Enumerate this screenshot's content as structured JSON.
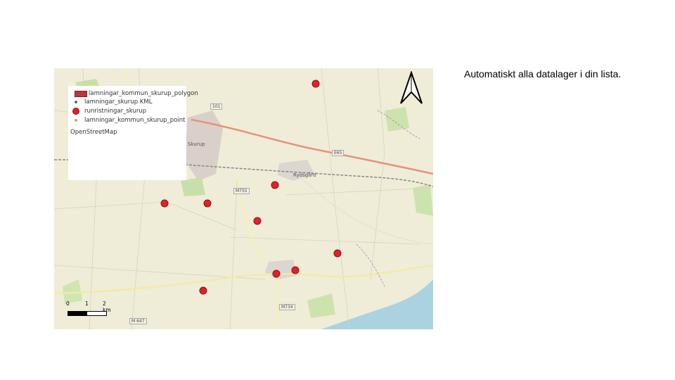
{
  "map": {
    "legend": {
      "items": [
        {
          "label": "lamningar_kommun_skurup_polygon",
          "symbol": "polygon-fill",
          "color": "#b83a3a"
        },
        {
          "label": "lamningar_skurup KML",
          "symbol": "dot",
          "color": "#666666"
        },
        {
          "label": "runristningar_skurup",
          "symbol": "red-circle",
          "color": "#e02020"
        },
        {
          "label": "lamningar_kommun_skurup_point",
          "symbol": "dot",
          "color": "#c8b040"
        }
      ],
      "basemap_label": "OpenStreetMap"
    },
    "place_labels": {
      "skurup": "Skurup",
      "rydsgard": "Rydsgård",
      "road_m755": "M755",
      "road_m734": "M734",
      "road_e65": "E65",
      "road_101": "101",
      "road_m647": "M 647"
    },
    "scale": {
      "tick_0": "0",
      "tick_1": "1",
      "tick_2": "2 km"
    },
    "north_arrow": "north-arrow-icon",
    "site_count": 9
  },
  "caption": "Automatiskt alla datalager i din lista."
}
